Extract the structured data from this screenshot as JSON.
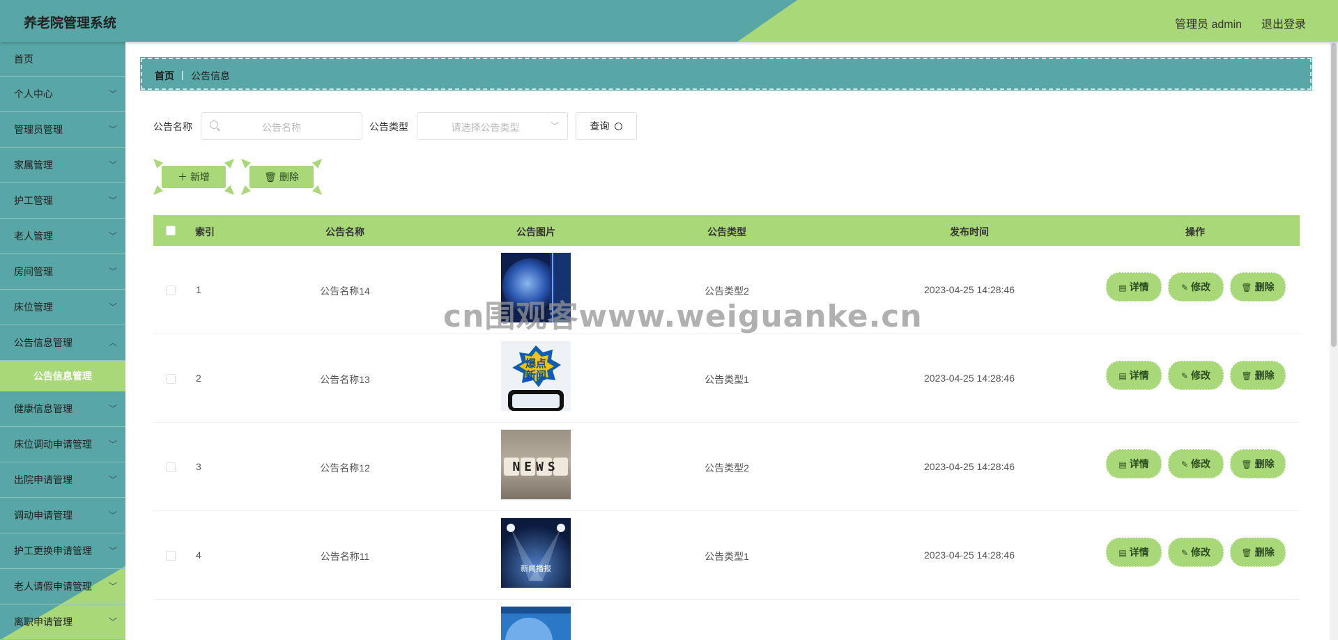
{
  "header": {
    "title": "养老院管理系统",
    "user": "管理员 admin",
    "logout": "退出登录"
  },
  "sidebar": {
    "items": [
      {
        "label": "首页"
      },
      {
        "label": "个人中心"
      },
      {
        "label": "管理员管理"
      },
      {
        "label": "家属管理"
      },
      {
        "label": "护工管理"
      },
      {
        "label": "老人管理"
      },
      {
        "label": "房间管理"
      },
      {
        "label": "床位管理"
      },
      {
        "label": "公告信息管理"
      },
      {
        "label": "健康信息管理"
      },
      {
        "label": "床位调动申请管理"
      },
      {
        "label": "出院申请管理"
      },
      {
        "label": "调动申请管理"
      },
      {
        "label": "护工更换申请管理"
      },
      {
        "label": "老人请假申请管理"
      },
      {
        "label": "离职申请管理"
      }
    ],
    "active_sub": "公告信息管理"
  },
  "breadcrumb": {
    "home": "首页",
    "sep": "|",
    "current": "公告信息"
  },
  "search": {
    "name_label": "公告名称",
    "name_placeholder": "公告名称",
    "type_label": "公告类型",
    "type_placeholder": "请选择公告类型",
    "query_label": "查询"
  },
  "toolbar": {
    "add_label": "新增",
    "delete_label": "删除"
  },
  "table": {
    "headers": {
      "index": "索引",
      "name": "公告名称",
      "image": "公告图片",
      "type": "公告类型",
      "time": "发布时间",
      "ops": "操作"
    },
    "rows": [
      {
        "index": "1",
        "name": "公告名称14",
        "type": "公告类型2",
        "time": "2023-04-25 14:28:46",
        "img": "globe"
      },
      {
        "index": "2",
        "name": "公告名称13",
        "type": "公告类型1",
        "time": "2023-04-25 14:28:46",
        "img": "burst"
      },
      {
        "index": "3",
        "name": "公告名称12",
        "type": "公告类型2",
        "time": "2023-04-25 14:28:46",
        "img": "news"
      },
      {
        "index": "4",
        "name": "公告名称11",
        "type": "公告类型1",
        "time": "2023-04-25 14:28:46",
        "img": "stage"
      }
    ],
    "row_actions": {
      "detail": "详情",
      "edit": "修改",
      "delete": "删除"
    },
    "thumb_text": {
      "burst": "爆点\n新闻",
      "news": "NEWS",
      "stage": "新闻播报"
    }
  },
  "watermark": "cn围观客www.weiguanke.cn",
  "colors": {
    "teal": "#59a6a6",
    "green": "#a8d878"
  }
}
